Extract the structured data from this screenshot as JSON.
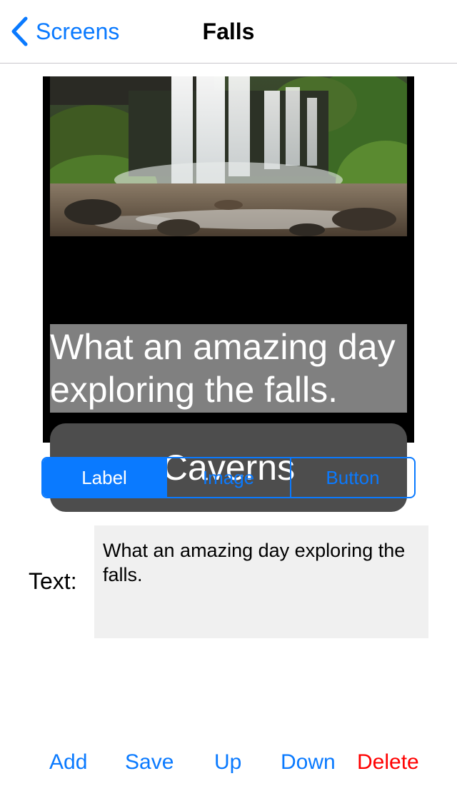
{
  "nav": {
    "back_label": "Screens",
    "title": "Falls"
  },
  "preview": {
    "label_text": "What an amazing day exploring the falls.",
    "button_text": "Caverns"
  },
  "segmented": {
    "options": [
      "Label",
      "Image",
      "Button"
    ],
    "selected": "Label"
  },
  "editor": {
    "text_label": "Text:",
    "text_value": "What an amazing day exploring the falls."
  },
  "toolbar": {
    "add": "Add",
    "save": "Save",
    "up": "Up",
    "down": "Down",
    "delete": "Delete"
  },
  "colors": {
    "accent": "#0a7aff",
    "danger": "#ff0000",
    "label_bg": "#808080",
    "button_bg": "#4d4d4d",
    "field_bg": "#f0f0f0"
  },
  "icons": {
    "back": "chevron-left-icon"
  }
}
